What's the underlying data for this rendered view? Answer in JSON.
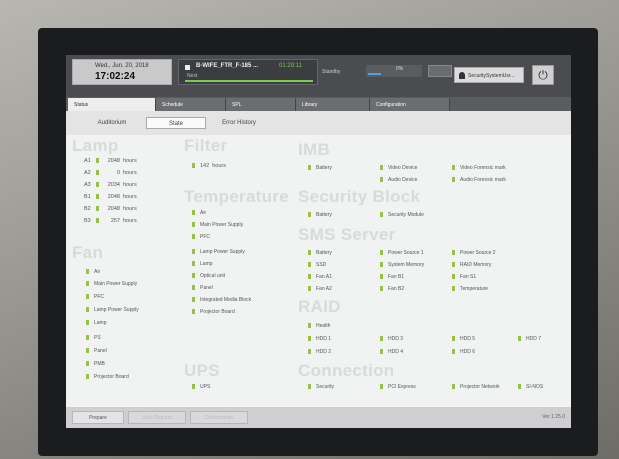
{
  "header": {
    "date": "Wed., Jun. 20, 2018",
    "time": "17:02:24",
    "show_title": "B-WIFE_FTR_F-185 ...",
    "show_time": "01:29:11",
    "show_next": "Next",
    "state": "Standby",
    "progress_label": "0%",
    "progress_value": 0.25,
    "gray_button": "Stop",
    "username": "SecuritySystemUsr..."
  },
  "main_tabs": [
    "Status",
    "Schedule",
    "SPL",
    "Library",
    "Configuration"
  ],
  "sub_tabs": [
    "Auditorium",
    "State",
    "Error History"
  ],
  "lamp": {
    "title": "Lamp",
    "rows": [
      {
        "name": "A1",
        "value": "2048",
        "unit": "hours"
      },
      {
        "name": "A2",
        "value": "0",
        "unit": "hours"
      },
      {
        "name": "A3",
        "value": "2034",
        "unit": "hours"
      },
      {
        "name": "B1",
        "value": "2048",
        "unit": "hours"
      },
      {
        "name": "B2",
        "value": "2048",
        "unit": "hours"
      },
      {
        "name": "B3",
        "value": "257",
        "unit": "hours"
      }
    ]
  },
  "filter": {
    "title": "Filter",
    "value": "142",
    "unit": "hours"
  },
  "imb": {
    "title": "IMB",
    "items": [
      "Battery",
      "Video Device",
      "Video Forensic mark",
      "Audio Device",
      "Audio Forensic mark"
    ]
  },
  "temperature": {
    "title": "Temperature",
    "items": [
      "Air",
      "Main Power Supply",
      "PFC",
      "Lamp Power Supply",
      "Lamp",
      "Optical unit",
      "Panel",
      "Integrated Media Block",
      "Projector Board"
    ]
  },
  "security_block": {
    "title": "Security Block",
    "items": [
      "Battery",
      "Security Module"
    ]
  },
  "sms_server": {
    "title": "SMS Server",
    "items": [
      "Battery",
      "SSD",
      "Fan A1",
      "Fan A2",
      "Power Source 1",
      "System Memory",
      "Fan B1",
      "Fan B2",
      "Power Source 2",
      "RAID Memory",
      "Fan S1",
      "Temperature"
    ]
  },
  "fan": {
    "title": "Fan",
    "items": [
      "Air",
      "Main Power Supply",
      "PFC",
      "Lamp Power Supply",
      "Lamp",
      "PS",
      "Panel",
      "PMB",
      "Projector Board"
    ]
  },
  "raid": {
    "title": "RAID",
    "items": [
      "Health",
      "HDD 1",
      "HDD 2",
      "HDD 3",
      "HDD 4",
      "HDD 5",
      "HDD 6",
      "HDD 7"
    ]
  },
  "ups": {
    "title": "UPS",
    "items": [
      "UPS"
    ]
  },
  "connection": {
    "title": "Connection",
    "items": [
      "Security",
      "PCI Express",
      "Projector Network",
      "SI-NOS"
    ]
  },
  "footer": {
    "buttons": [
      "Prepare",
      "Start Reports",
      "Confirmation"
    ],
    "version": "Ver 1.25.0"
  }
}
